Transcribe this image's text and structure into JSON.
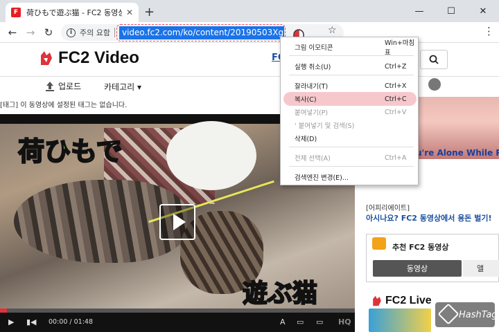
{
  "window": {
    "tab_title": "荷ひもで遊ぶ猫 - FC2 동영상",
    "favicon_text": "F",
    "tab_close": "✕",
    "new_tab": "+",
    "minimize": "—",
    "maximize": "☐",
    "close": "✕"
  },
  "toolbar": {
    "back": "←",
    "forward": "→",
    "reload": "↻",
    "info_glyph": "i",
    "security_label": "주의 요함",
    "url": "video.fc2.com/ko/content/20190503XgLuWfst",
    "star": "☆",
    "menu": "⋮"
  },
  "page": {
    "logo_text": "FC2 Video",
    "header_link": "FC",
    "search_glyph": "🔍",
    "upload_label": "업로드",
    "category_label": "카테고리 ▾",
    "tag_notice": "[태그] 이 동영상에 설정된 태그는 없습니다.",
    "video": {
      "caption_top": "荷ひもで",
      "caption_bottom": "遊ぶ猫",
      "time": "00:00 / 01:48",
      "progress_fraction": 0.02,
      "hq": "HQ",
      "font_btn": "A",
      "subtitle_btn": "▭",
      "screen_btn": "▭",
      "fullscreen_btn": "⛶",
      "play_btn": "▶",
      "volume_btn": "▮◀"
    },
    "sidebar": {
      "ad_text": "u're Alone While Pl",
      "affiliate_tag": "[어피리에이트]",
      "affiliate_link": "아시나요? FC2 동영상에서 용돈 벌기!",
      "recommended_title": "추천 FC2 동영상",
      "tab_video": "동영상",
      "tab_album": "앨",
      "live_logo": "FC2 Live"
    },
    "watermark": "HashTag"
  },
  "context_menu": {
    "items": [
      {
        "label": "그림 이모티콘",
        "shortcut": "Win+마침표",
        "disabled": false,
        "highlight": false
      },
      {
        "label": "실행 취소(U)",
        "shortcut": "Ctrl+Z",
        "disabled": false,
        "highlight": false
      },
      {
        "label": "잘라내기(T)",
        "shortcut": "Ctrl+X",
        "disabled": false,
        "highlight": false
      },
      {
        "label": "복사(C)",
        "shortcut": "Ctrl+C",
        "disabled": false,
        "highlight": true
      },
      {
        "label": "붙여넣기(P)",
        "shortcut": "Ctrl+V",
        "disabled": true,
        "highlight": false
      },
      {
        "label": "' 붙여넣기 및 검색(S)",
        "shortcut": "",
        "disabled": true,
        "highlight": false
      },
      {
        "label": "삭제(D)",
        "shortcut": "",
        "disabled": false,
        "highlight": false
      },
      {
        "label": "전체 선택(A)",
        "shortcut": "Ctrl+A",
        "disabled": true,
        "highlight": false
      },
      {
        "label": "검색엔진 변경(E)...",
        "shortcut": "",
        "disabled": false,
        "highlight": false
      }
    ]
  },
  "colors": {
    "accent": "#1a73e8",
    "highlight": "#f6c8cc",
    "brand_red": "#e0323a"
  }
}
